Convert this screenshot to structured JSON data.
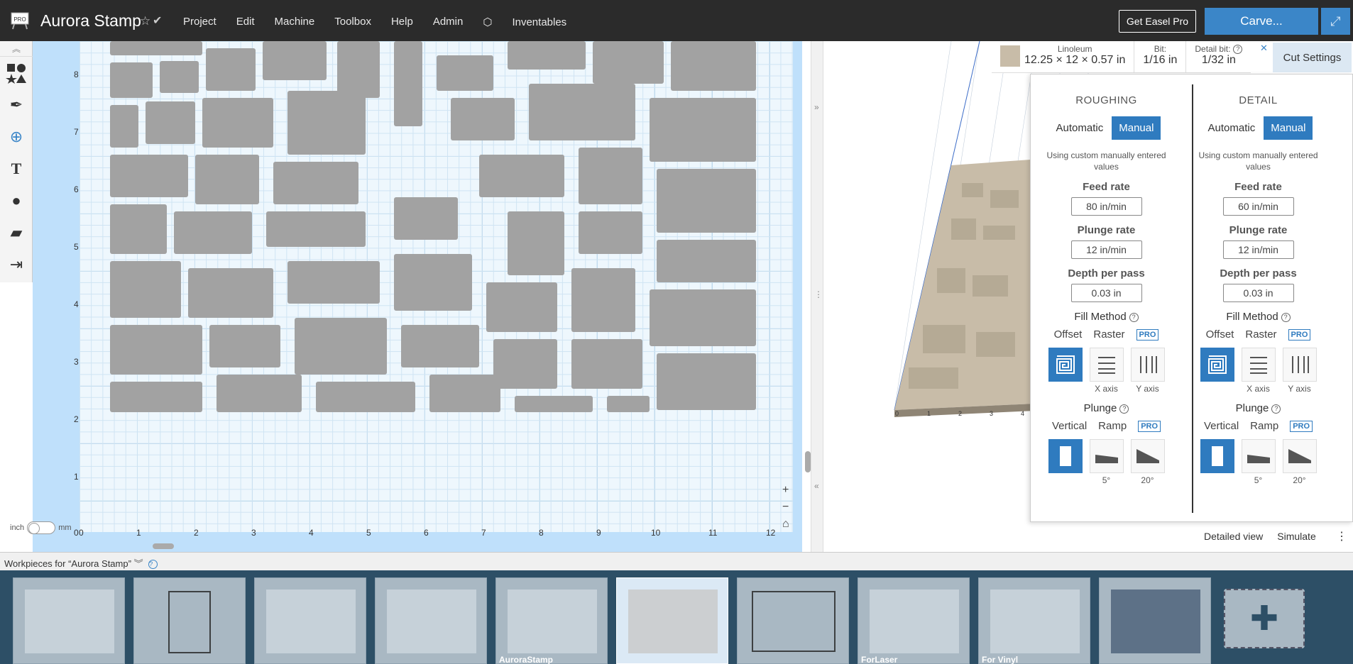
{
  "app": {
    "title": "Aurora Stamp",
    "badge": "PRO",
    "menu": [
      "Project",
      "Edit",
      "Machine",
      "Toolbox",
      "Help",
      "Admin",
      "Inventables"
    ],
    "get_pro_label": "Get Easel Pro",
    "carve_label": "Carve..."
  },
  "canvas": {
    "y_ticks": [
      "8",
      "7",
      "6",
      "5",
      "4",
      "3",
      "2",
      "1"
    ],
    "x_ticks": [
      "0",
      "1",
      "2",
      "3",
      "4",
      "5",
      "6",
      "7",
      "8",
      "9",
      "10",
      "11",
      "12"
    ],
    "x_origin": "0",
    "unit_inch": "inch",
    "unit_mm": "mm"
  },
  "material": {
    "name": "Linoleum",
    "dims": "12.25 × 12 × 0.57 in",
    "bit_label": "Bit:",
    "bit_value": "1/16 in",
    "detail_bit_label": "Detail bit:",
    "detail_bit_value": "1/32 in",
    "cut_settings_label": "Cut Settings"
  },
  "preview_axis": [
    "0",
    "1",
    "2",
    "3",
    "4"
  ],
  "cut_settings": {
    "roughing": {
      "title": "ROUGHING",
      "mode_auto": "Automatic",
      "mode_manual": "Manual",
      "note": "Using custom manually entered values",
      "feed_label": "Feed rate",
      "feed_value": "80 in/min",
      "plunge_label": "Plunge rate",
      "plunge_value": "12 in/min",
      "depth_label": "Depth per pass",
      "depth_value": "0.03 in",
      "fill_label": "Fill Method",
      "fill_offset": "Offset",
      "fill_raster": "Raster",
      "pro": "PRO",
      "x_axis": "X axis",
      "y_axis": "Y axis",
      "plunge_section": "Plunge",
      "vertical": "Vertical",
      "ramp": "Ramp",
      "ramp5": "5°",
      "ramp20": "20°"
    },
    "detail": {
      "title": "DETAIL",
      "mode_auto": "Automatic",
      "mode_manual": "Manual",
      "note": "Using custom manually entered values",
      "feed_label": "Feed rate",
      "feed_value": "60 in/min",
      "plunge_label": "Plunge rate",
      "plunge_value": "12 in/min",
      "depth_label": "Depth per pass",
      "depth_value": "0.03 in",
      "fill_label": "Fill Method",
      "fill_offset": "Offset",
      "fill_raster": "Raster",
      "pro": "PRO",
      "x_axis": "X axis",
      "y_axis": "Y axis",
      "plunge_section": "Plunge",
      "vertical": "Vertical",
      "ramp": "Ramp",
      "ramp5": "5°",
      "ramp20": "20°"
    }
  },
  "view": {
    "detailed": "Detailed view",
    "simulate": "Simulate"
  },
  "workpieces": {
    "header": "Workpieces for “Aurora Stamp”",
    "items": [
      "",
      "",
      "",
      "",
      "AuroraStamp",
      "",
      "",
      "ForLaser",
      "For Vinyl",
      ""
    ]
  }
}
